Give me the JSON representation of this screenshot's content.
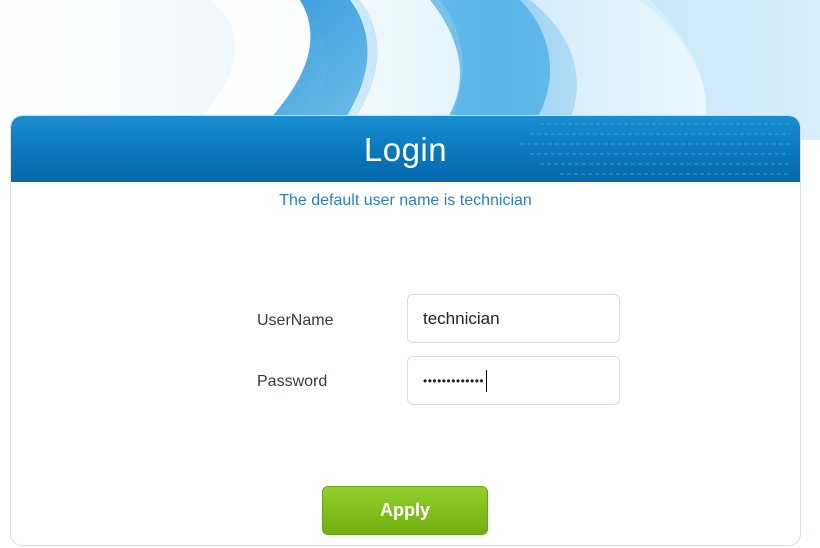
{
  "login": {
    "title": "Login",
    "hint": "The default user name is technician"
  },
  "form": {
    "username_label": "UserName",
    "username_value": "technician",
    "password_label": "Password",
    "password_masked": "•••••••••••••",
    "apply_label": "Apply"
  },
  "colors": {
    "header_blue": "#0a77bd",
    "hint_blue": "#2a7fc2",
    "apply_green": "#7fbd1c"
  }
}
